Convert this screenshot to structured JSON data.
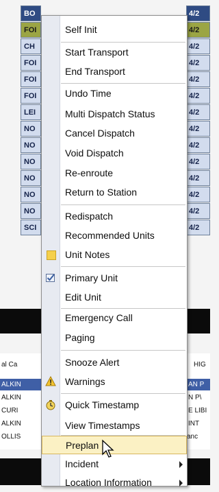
{
  "grid": {
    "left_cells": [
      "BO",
      "FOI",
      "CH",
      "FOI",
      "FOI",
      "FOI",
      "LEI",
      "NO",
      "NO",
      "NO",
      "NO",
      "NO",
      "NO",
      "SCI"
    ],
    "right_cells": [
      "4/2",
      "4/2",
      "4/2",
      "4/2",
      "4/2",
      "4/2",
      "4/2",
      "4/2",
      "4/2",
      "4/2",
      "4/2",
      "4/2",
      "4/2",
      "4/2"
    ]
  },
  "panel": {
    "header_left": "al Ca",
    "header_right": "HIG",
    "rows": [
      {
        "left": "ALKIN",
        "right": "AN P"
      },
      {
        "left": "ALKIN",
        "right": "N P\\"
      },
      {
        "left": "CURI",
        "right": "E LIBI"
      },
      {
        "left": "ALKIN",
        "right": "INT"
      },
      {
        "left": "OLLIS",
        "right": "Janc"
      }
    ]
  },
  "menu": {
    "items": [
      {
        "label": "Self Init",
        "icon": ""
      },
      {
        "label": "Start Transport",
        "icon": ""
      },
      {
        "label": "End Transport",
        "icon": ""
      },
      {
        "label": "Undo Time",
        "icon": ""
      },
      {
        "label": "Multi Dispatch Status",
        "icon": ""
      },
      {
        "label": "Cancel Dispatch",
        "icon": ""
      },
      {
        "label": "Void Dispatch",
        "icon": ""
      },
      {
        "label": "Re-enroute",
        "icon": ""
      },
      {
        "label": "Return to Station",
        "icon": ""
      },
      {
        "label": "Redispatch",
        "icon": ""
      },
      {
        "label": "Recommended Units",
        "icon": ""
      },
      {
        "label": "Unit Notes",
        "icon": "note-icon"
      },
      {
        "label": "Primary Unit",
        "icon": "checkbox-icon"
      },
      {
        "label": "Edit Unit",
        "icon": ""
      },
      {
        "label": "Emergency Call",
        "icon": ""
      },
      {
        "label": "Paging",
        "icon": ""
      },
      {
        "label": "Snooze Alert",
        "icon": ""
      },
      {
        "label": "Warnings",
        "icon": "warning-icon"
      },
      {
        "label": "Quick Timestamp",
        "icon": "clock-icon"
      },
      {
        "label": "View Timestamps",
        "icon": ""
      },
      {
        "label": "Preplan",
        "icon": ""
      },
      {
        "label": "Incident",
        "icon": ""
      },
      {
        "label": "Location Information",
        "icon": ""
      }
    ]
  },
  "colors": {
    "grid_header": "#2f4b83",
    "grid_selected": "#9ba544",
    "grid_cell": "#d2dcee",
    "menu_hover": "#fbf1c4"
  }
}
